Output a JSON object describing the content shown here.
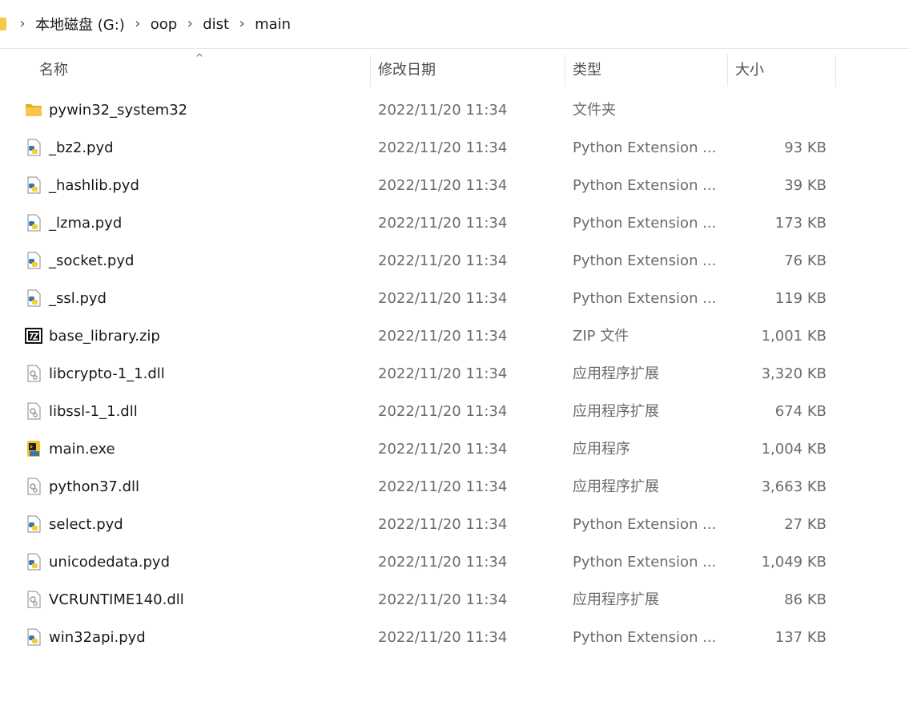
{
  "breadcrumb": [
    "本地磁盘 (G:)",
    "oop",
    "dist",
    "main"
  ],
  "columns": {
    "name": "名称",
    "date": "修改日期",
    "type": "类型",
    "size": "大小"
  },
  "files": [
    {
      "name": "pywin32_system32",
      "date": "2022/11/20 11:34",
      "type": "文件夹",
      "size": "",
      "icon": "folder-icon"
    },
    {
      "name": "_bz2.pyd",
      "date": "2022/11/20 11:34",
      "type": "Python Extension ...",
      "size": "93 KB",
      "icon": "python-file-icon"
    },
    {
      "name": "_hashlib.pyd",
      "date": "2022/11/20 11:34",
      "type": "Python Extension ...",
      "size": "39 KB",
      "icon": "python-file-icon"
    },
    {
      "name": "_lzma.pyd",
      "date": "2022/11/20 11:34",
      "type": "Python Extension ...",
      "size": "173 KB",
      "icon": "python-file-icon"
    },
    {
      "name": "_socket.pyd",
      "date": "2022/11/20 11:34",
      "type": "Python Extension ...",
      "size": "76 KB",
      "icon": "python-file-icon"
    },
    {
      "name": "_ssl.pyd",
      "date": "2022/11/20 11:34",
      "type": "Python Extension ...",
      "size": "119 KB",
      "icon": "python-file-icon"
    },
    {
      "name": "base_library.zip",
      "date": "2022/11/20 11:34",
      "type": "ZIP 文件",
      "size": "1,001 KB",
      "icon": "7z-archive-icon"
    },
    {
      "name": "libcrypto-1_1.dll",
      "date": "2022/11/20 11:34",
      "type": "应用程序扩展",
      "size": "3,320 KB",
      "icon": "dll-file-icon"
    },
    {
      "name": "libssl-1_1.dll",
      "date": "2022/11/20 11:34",
      "type": "应用程序扩展",
      "size": "674 KB",
      "icon": "dll-file-icon"
    },
    {
      "name": "main.exe",
      "date": "2022/11/20 11:34",
      "type": "应用程序",
      "size": "1,004 KB",
      "icon": "exe-icon"
    },
    {
      "name": "python37.dll",
      "date": "2022/11/20 11:34",
      "type": "应用程序扩展",
      "size": "3,663 KB",
      "icon": "dll-file-icon"
    },
    {
      "name": "select.pyd",
      "date": "2022/11/20 11:34",
      "type": "Python Extension ...",
      "size": "27 KB",
      "icon": "python-file-icon"
    },
    {
      "name": "unicodedata.pyd",
      "date": "2022/11/20 11:34",
      "type": "Python Extension ...",
      "size": "1,049 KB",
      "icon": "python-file-icon"
    },
    {
      "name": "VCRUNTIME140.dll",
      "date": "2022/11/20 11:34",
      "type": "应用程序扩展",
      "size": "86 KB",
      "icon": "dll-file-icon"
    },
    {
      "name": "win32api.pyd",
      "date": "2022/11/20 11:34",
      "type": "Python Extension ...",
      "size": "137 KB",
      "icon": "python-file-icon"
    }
  ],
  "colors": {
    "folder": "#f8c74a",
    "python_blue": "#3a75b0",
    "python_yellow": "#f5cf3a",
    "secondary_text": "#6b6b6b"
  }
}
